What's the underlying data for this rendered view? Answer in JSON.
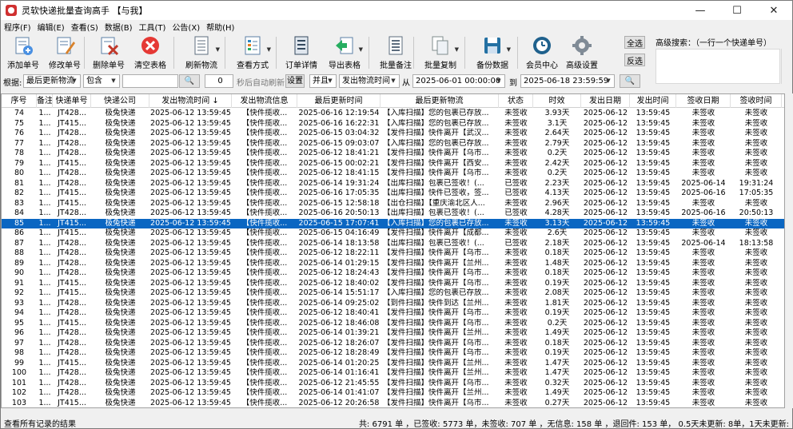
{
  "window": {
    "title": "灵软快递批量查询高手 【与我】",
    "minimize": "—",
    "maximize": "☐",
    "close": "✕"
  },
  "menu": [
    "程序(F)",
    "编辑(E)",
    "查看(S)",
    "数据(B)",
    "工具(T)",
    "公告(X)",
    "帮助(H)"
  ],
  "toolbar": [
    {
      "label": "添加单号",
      "icon": "add-number-icon",
      "color": "#4a90e2"
    },
    {
      "label": "修改单号",
      "icon": "edit-number-icon",
      "color": "#d9822b"
    },
    {
      "label": "删除单号",
      "icon": "delete-number-icon",
      "color": "#c0392b"
    },
    {
      "label": "清空表格",
      "icon": "clear-table-icon",
      "color": "#e53935"
    },
    {
      "label": "刷新物流",
      "icon": "refresh-logistics-icon",
      "color": "#5d6d7e"
    },
    {
      "label": "查看方式",
      "icon": "view-mode-icon",
      "color": "#2e86c1"
    },
    {
      "label": "订单详情",
      "icon": "order-detail-icon",
      "color": "#34495e"
    },
    {
      "label": "导出表格",
      "icon": "export-table-icon",
      "color": "#27ae60"
    },
    {
      "label": "批量备注",
      "icon": "batch-note-icon",
      "color": "#5d6d7e"
    },
    {
      "label": "批量复制",
      "icon": "batch-copy-icon",
      "color": "#7f8c8d"
    },
    {
      "label": "备份数据",
      "icon": "backup-data-icon",
      "color": "#2471a3"
    },
    {
      "label": "会员中心",
      "icon": "member-center-icon",
      "color": "#1f618d"
    },
    {
      "label": "高级设置",
      "icon": "settings-gear-icon",
      "color": "#808b96"
    }
  ],
  "select_all": "全选",
  "invert_select": "反选",
  "advanced_search_label": "高级搜索：（一行一个快递单号）",
  "filter": {
    "label": "根据:",
    "field": "最后更新物流",
    "op": "包含",
    "keyword": "",
    "interval": "0",
    "auto_refresh": "秒后自动刷新",
    "settings_btn": "设置",
    "logic": "并且",
    "time_field": "发出物流时间",
    "from_label": "从",
    "from": "2025-06-01 00:00:00",
    "to_label": "到",
    "to": "2025-06-18 23:59:59"
  },
  "columns": [
    "序号",
    "备注",
    "快递单号",
    "快递公司",
    "发出物流时间 ↓",
    "发出物流信息",
    "最后更新时间",
    "最后更新物流",
    "状态",
    "时效",
    "发出日期",
    "发出时间",
    "签收日期",
    "签收时间"
  ],
  "rows": [
    [
      "74",
      "1...",
      "JT428...",
      "极兔快递",
      "2025-06-12 13:59:45",
      "【快件揽收...",
      "2025-06-16 12:19:54",
      "【入库扫描】您的包裹已存放...",
      "未签收",
      "3.93天",
      "2025-06-12",
      "13:59:45",
      "未签收",
      "未签收"
    ],
    [
      "75",
      "1...",
      "JT415...",
      "极兔快递",
      "2025-06-12 13:59:45",
      "【快件揽收...",
      "2025-06-16 16:22:31",
      "【入库扫描】您的包裹已存放...",
      "未签收",
      "3.1天",
      "2025-06-12",
      "13:59:45",
      "未签收",
      "未签收"
    ],
    [
      "76",
      "1...",
      "JT428...",
      "极兔快递",
      "2025-06-12 13:59:45",
      "【快件揽收...",
      "2025-06-15 03:04:32",
      "【发件扫描】快件离开【武汉...",
      "未签收",
      "2.64天",
      "2025-06-12",
      "13:59:45",
      "未签收",
      "未签收"
    ],
    [
      "77",
      "1...",
      "JT428...",
      "极兔快递",
      "2025-06-12 13:59:45",
      "【快件揽收...",
      "2025-06-15 09:03:07",
      "【入库扫描】您的包裹已存放...",
      "未签收",
      "2.79天",
      "2025-06-12",
      "13:59:45",
      "未签收",
      "未签收"
    ],
    [
      "78",
      "1...",
      "JT428...",
      "极兔快递",
      "2025-06-12 13:59:45",
      "【快件揽收...",
      "2025-06-12 18:41:21",
      "【发件扫描】快件离开【乌市...",
      "未签收",
      "0.2天",
      "2025-06-12",
      "13:59:45",
      "未签收",
      "未签收"
    ],
    [
      "79",
      "1...",
      "JT415...",
      "极兔快递",
      "2025-06-12 13:59:45",
      "【快件揽收...",
      "2025-06-15 00:02:21",
      "【发件扫描】快件离开【西安...",
      "未签收",
      "2.42天",
      "2025-06-12",
      "13:59:45",
      "未签收",
      "未签收"
    ],
    [
      "80",
      "1...",
      "JT428...",
      "极兔快递",
      "2025-06-12 13:59:45",
      "【快件揽收...",
      "2025-06-12 18:41:15",
      "【发件扫描】快件离开【乌市...",
      "未签收",
      "0.2天",
      "2025-06-12",
      "13:59:45",
      "未签收",
      "未签收"
    ],
    [
      "81",
      "1...",
      "JT428...",
      "极兔快递",
      "2025-06-12 13:59:45",
      "【快件揽收...",
      "2025-06-14 19:31:24",
      "【出库扫描】包裹已签收！(...",
      "已签收",
      "2.23天",
      "2025-06-12",
      "13:59:45",
      "2025-06-14",
      "19:31:24"
    ],
    [
      "82",
      "1...",
      "JT415...",
      "极兔快递",
      "2025-06-12 13:59:45",
      "【快件揽收...",
      "2025-06-16 17:05:35",
      "【出库扫描】快件已签收，签...",
      "已签收",
      "4.13天",
      "2025-06-12",
      "13:59:45",
      "2025-06-16",
      "17:05:35"
    ],
    [
      "83",
      "1...",
      "JT415...",
      "极兔快递",
      "2025-06-12 13:59:45",
      "【快件揽收...",
      "2025-06-15 12:58:18",
      "【出仓扫描】【重庆渝北区人...",
      "未签收",
      "2.96天",
      "2025-06-12",
      "13:59:45",
      "未签收",
      "未签收"
    ],
    [
      "84",
      "1...",
      "JT428...",
      "极兔快递",
      "2025-06-12 13:59:45",
      "【快件揽收...",
      "2025-06-16 20:50:13",
      "【出库扫描】包裹已签收！(...",
      "已签收",
      "4.28天",
      "2025-06-12",
      "13:59:45",
      "2025-06-16",
      "20:50:13"
    ],
    [
      "85",
      "1...",
      "JT415...",
      "极兔快递",
      "2025-06-12 13:59:45",
      "【快件揽收...",
      "2025-06-15 17:07:41",
      "【入库扫描】您的包裹已存放...",
      "未签收",
      "3.13天",
      "2025-06-12",
      "13:59:45",
      "未签收",
      "未签收"
    ],
    [
      "86",
      "1...",
      "JT415...",
      "极兔快递",
      "2025-06-12 13:59:45",
      "【快件揽收...",
      "2025-06-15 04:16:49",
      "【发件扫描】快件离开【成都...",
      "未签收",
      "2.6天",
      "2025-06-12",
      "13:59:45",
      "未签收",
      "未签收"
    ],
    [
      "87",
      "1...",
      "JT428...",
      "极兔快递",
      "2025-06-12 13:59:45",
      "【快件揽收...",
      "2025-06-14 18:13:58",
      "【出库扫描】包裹已签收！(...",
      "已签收",
      "2.18天",
      "2025-06-12",
      "13:59:45",
      "2025-06-14",
      "18:13:58"
    ],
    [
      "88",
      "1...",
      "JT428...",
      "极兔快递",
      "2025-06-12 13:59:45",
      "【快件揽收...",
      "2025-06-12 18:22:11",
      "【发件扫描】快件离开【乌市...",
      "未签收",
      "0.18天",
      "2025-06-12",
      "13:59:45",
      "未签收",
      "未签收"
    ],
    [
      "89",
      "1...",
      "JT428...",
      "极兔快递",
      "2025-06-12 13:59:45",
      "【快件揽收...",
      "2025-06-14 01:29:15",
      "【发件扫描】快件离开【兰州...",
      "未签收",
      "1.48天",
      "2025-06-12",
      "13:59:45",
      "未签收",
      "未签收"
    ],
    [
      "90",
      "1...",
      "JT428...",
      "极兔快递",
      "2025-06-12 13:59:45",
      "【快件揽收...",
      "2025-06-12 18:24:43",
      "【发件扫描】快件离开【乌市...",
      "未签收",
      "0.18天",
      "2025-06-12",
      "13:59:45",
      "未签收",
      "未签收"
    ],
    [
      "91",
      "1...",
      "JT415...",
      "极兔快递",
      "2025-06-12 13:59:45",
      "【快件揽收...",
      "2025-06-12 18:40:02",
      "【发件扫描】快件离开【乌市...",
      "未签收",
      "0.19天",
      "2025-06-12",
      "13:59:45",
      "未签收",
      "未签收"
    ],
    [
      "92",
      "1...",
      "JT415...",
      "极兔快递",
      "2025-06-12 13:59:45",
      "【快件揽收...",
      "2025-06-14 15:51:17",
      "【入库扫描】您的包裹已存放...",
      "未签收",
      "2.08天",
      "2025-06-12",
      "13:59:45",
      "未签收",
      "未签收"
    ],
    [
      "93",
      "1...",
      "JT428...",
      "极兔快递",
      "2025-06-12 13:59:45",
      "【快件揽收...",
      "2025-06-14 09:25:02",
      "【到件扫描】快件到达【兰州...",
      "未签收",
      "1.81天",
      "2025-06-12",
      "13:59:45",
      "未签收",
      "未签收"
    ],
    [
      "94",
      "1...",
      "JT428...",
      "极兔快递",
      "2025-06-12 13:59:45",
      "【快件揽收...",
      "2025-06-12 18:40:41",
      "【发件扫描】快件离开【乌市...",
      "未签收",
      "0.19天",
      "2025-06-12",
      "13:59:45",
      "未签收",
      "未签收"
    ],
    [
      "95",
      "1...",
      "JT415...",
      "极兔快递",
      "2025-06-12 13:59:45",
      "【快件揽收...",
      "2025-06-12 18:46:08",
      "【发件扫描】快件离开【乌市...",
      "未签收",
      "0.2天",
      "2025-06-12",
      "13:59:45",
      "未签收",
      "未签收"
    ],
    [
      "96",
      "1...",
      "JT428...",
      "极兔快递",
      "2025-06-12 13:59:45",
      "【快件揽收...",
      "2025-06-14 01:39:21",
      "【发件扫描】快件离开【兰州...",
      "未签收",
      "1.49天",
      "2025-06-12",
      "13:59:45",
      "未签收",
      "未签收"
    ],
    [
      "97",
      "1...",
      "JT428...",
      "极兔快递",
      "2025-06-12 13:59:45",
      "【快件揽收...",
      "2025-06-12 18:26:07",
      "【发件扫描】快件离开【乌市...",
      "未签收",
      "0.18天",
      "2025-06-12",
      "13:59:45",
      "未签收",
      "未签收"
    ],
    [
      "98",
      "1...",
      "JT428...",
      "极兔快递",
      "2025-06-12 13:59:45",
      "【快件揽收...",
      "2025-06-12 18:28:49",
      "【发件扫描】快件离开【乌市...",
      "未签收",
      "0.19天",
      "2025-06-12",
      "13:59:45",
      "未签收",
      "未签收"
    ],
    [
      "99",
      "1...",
      "JT415...",
      "极兔快递",
      "2025-06-12 13:59:45",
      "【快件揽收...",
      "2025-06-14 01:20:25",
      "【发件扫描】快件离开【兰州...",
      "未签收",
      "1.47天",
      "2025-06-12",
      "13:59:45",
      "未签收",
      "未签收"
    ],
    [
      "100",
      "1...",
      "JT428...",
      "极兔快递",
      "2025-06-12 13:59:45",
      "【快件揽收...",
      "2025-06-14 01:16:41",
      "【发件扫描】快件离开【兰州...",
      "未签收",
      "1.47天",
      "2025-06-12",
      "13:59:45",
      "未签收",
      "未签收"
    ],
    [
      "101",
      "1...",
      "JT428...",
      "极兔快递",
      "2025-06-12 13:59:45",
      "【快件揽收...",
      "2025-06-12 21:45:55",
      "【发件扫描】快件离开【乌市...",
      "未签收",
      "0.32天",
      "2025-06-12",
      "13:59:45",
      "未签收",
      "未签收"
    ],
    [
      "102",
      "1...",
      "JT428...",
      "极兔快递",
      "2025-06-12 13:59:45",
      "【快件揽收...",
      "2025-06-14 01:41:07",
      "【发件扫描】快件离开【兰州...",
      "未签收",
      "1.49天",
      "2025-06-12",
      "13:59:45",
      "未签收",
      "未签收"
    ],
    [
      "103",
      "1...",
      "JT415...",
      "极兔快递",
      "2025-06-12 13:59:45",
      "【快件揽收...",
      "2025-06-12 20:26:58",
      "【发件扫描】快件离开【乌市...",
      "未签收",
      "0.27天",
      "2025-06-12",
      "13:59:45",
      "未签收",
      "未签收"
    ]
  ],
  "selected_row": "85",
  "status": {
    "left": "查看所有记录的结果",
    "right": "共: 6791 单 ，已签收: 5773 单，未签收: 707 单 ，无信息: 158 单 ，退回件: 153 单， 0.5天未更新: 8单，1天未更新:"
  },
  "colors": {
    "selection": "#0a66c2",
    "window_bg": "#f0f0f0"
  }
}
